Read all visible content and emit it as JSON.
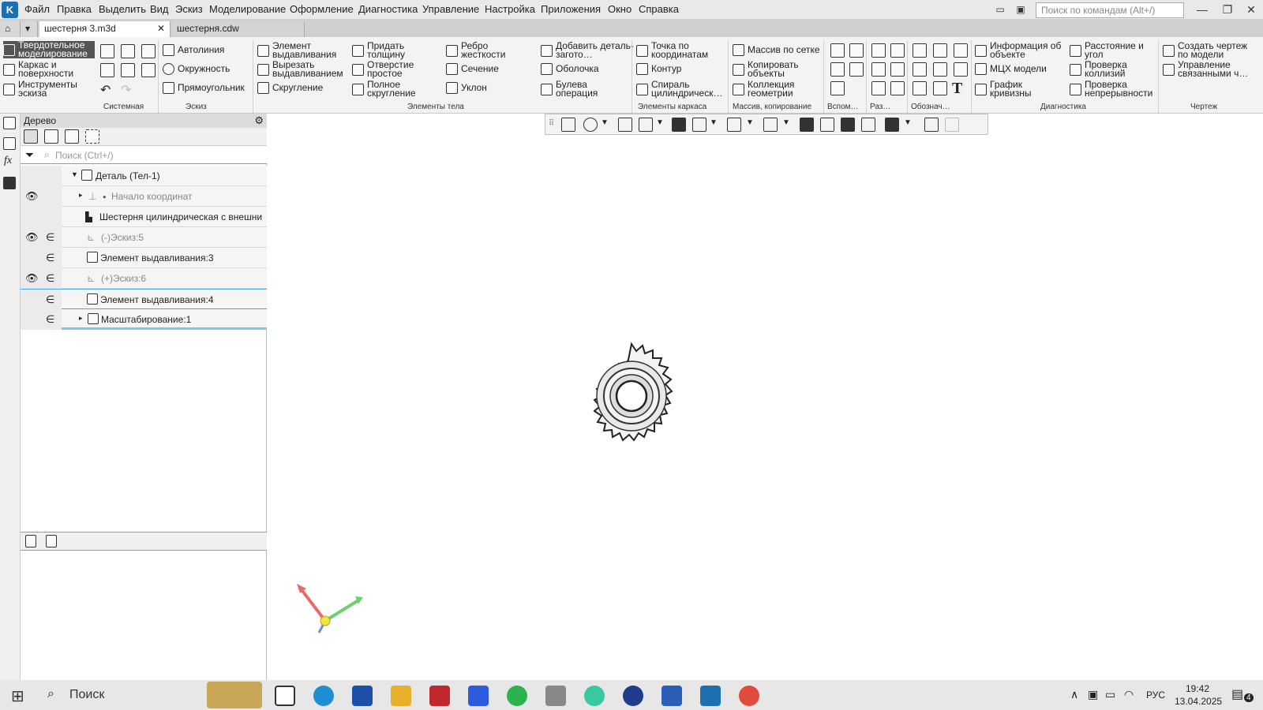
{
  "menu": {
    "items": [
      "Файл",
      "Правка",
      "Выделить",
      "Вид",
      "Эскиз",
      "Моделирование",
      "Оформление",
      "Диагностика",
      "Управление",
      "Настройка",
      "Приложения",
      "Окно",
      "Справка"
    ],
    "search_placeholder": "Поиск по командам (Alt+/)"
  },
  "tabs": [
    {
      "label": "шестерня 3.m3d",
      "active": true
    },
    {
      "label": "шестерня.cdw",
      "active": false
    }
  ],
  "ribbon": {
    "modes": [
      "Твердотельное моделирование",
      "Каркас и поверхности",
      "Инструменты эскиза"
    ],
    "sketch": [
      "Автолиния",
      "Окружность",
      "Прямоугольник"
    ],
    "body": [
      "Элемент выдавливания",
      "Вырезать выдавливанием",
      "Скругление",
      "Придать толщину",
      "Отверстие простое",
      "Полное скругление",
      "Ребро жесткости",
      "Сечение",
      "Уклон",
      "Добавить деталь-загото…",
      "Оболочка",
      "Булева операция"
    ],
    "frame": [
      "Точка по координатам",
      "Контур",
      "Спираль цилиндрическ…"
    ],
    "array": [
      "Массив по сетке",
      "Копировать объекты",
      "Коллекция геометрии"
    ],
    "diag": [
      "Информация об объекте",
      "МЦХ модели",
      "График кривизны",
      "Расстояние и угол",
      "Проверка коллизий",
      "Проверка непрерывности"
    ],
    "drawing": [
      "Создать чертеж по модели",
      "Управление связанными ч…"
    ],
    "group_labels": [
      "Системная",
      "Эскиз",
      "Элементы тела",
      "Элементы каркаса",
      "Массив, копирование",
      "Вспом…",
      "Раз…",
      "Обознач…",
      "Диагностика",
      "Чертеж"
    ]
  },
  "tree": {
    "title": "Дерево",
    "search_placeholder": "Поиск (Ctrl+/)",
    "rows": [
      {
        "label": "Деталь (Тел-1)",
        "bold": true
      },
      {
        "label": "Начало координат",
        "bold": false
      },
      {
        "label": "Шестерня цилиндрическая с внешни",
        "bold": true
      },
      {
        "label": "(-)Эскиз:5",
        "bold": false
      },
      {
        "label": "Элемент выдавливания:3",
        "bold": true
      },
      {
        "label": "(+)Эскиз:6",
        "bold": false
      },
      {
        "label": "Элемент выдавливания:4",
        "bold": true
      },
      {
        "label": "Масштабирование:1",
        "bold": true
      }
    ]
  },
  "taskbar": {
    "search": "Поиск",
    "lang": "РУС",
    "time": "19:42",
    "date": "13.04.2025",
    "notif_count": "4"
  }
}
